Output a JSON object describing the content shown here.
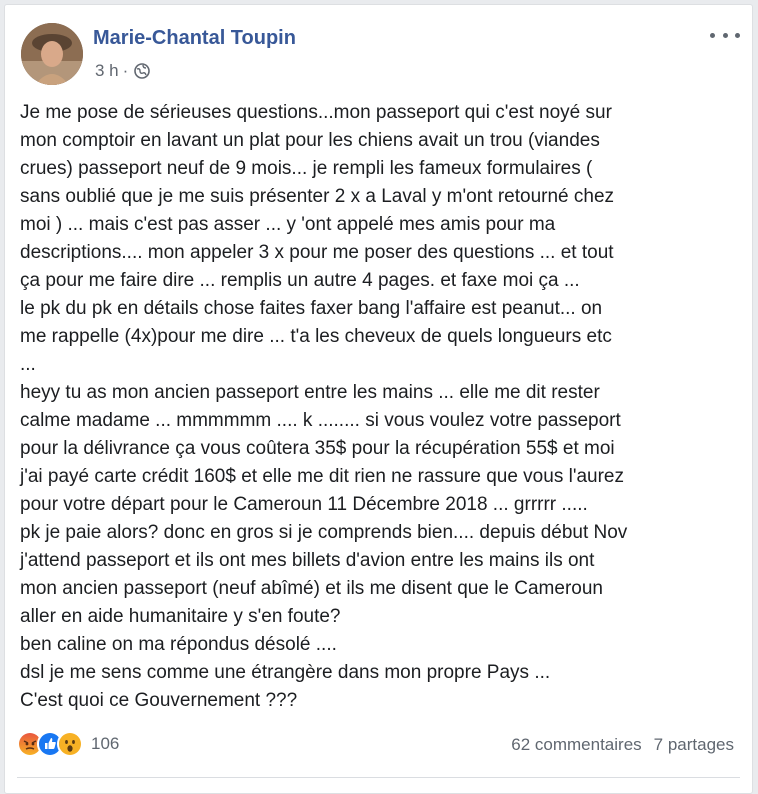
{
  "post": {
    "author": "Marie-Chantal Toupin",
    "time": "3 h",
    "privacy_icon": "globe-icon",
    "lines": [
      "Je me pose de sérieuses questions...mon passeport qui c'est noyé sur",
      "mon comptoir en lavant un plat pour les chiens avait un trou (viandes",
      "crues) passeport neuf de 9 mois... je rempli les fameux formulaires (",
      "sans oublié que je me suis présenter 2 x a Laval y m'ont retourné chez",
      "moi ) ... mais c'est pas asser ... y 'ont appelé mes amis pour ma",
      "descriptions.... mon appeler 3 x pour me poser des questions ... et tout",
      "ça pour me faire dire ... remplis un autre 4 pages. et faxe moi ça ...",
      "le pk du pk en détails chose faites faxer bang l'affaire est peanut... on",
      "me rappelle (4x)pour me dire ... t'a les cheveux de quels longueurs etc",
      "...",
      "heyy tu as mon ancien passeport entre les mains ... elle me dit rester",
      "calme madame ... mmmmmm .... k ........ si vous voulez votre passeport",
      "pour la délivrance ça vous coûtera 35$ pour la récupération 55$ et moi",
      "j'ai payé carte crédit 160$ et elle me dit rien ne rassure que vous l'aurez",
      "pour votre départ pour le Cameroun 11 Décembre 2018 ... grrrrr .....",
      "pk je paie alors? donc en gros si je comprends bien.... depuis début Nov",
      "j'attend passeport et ils ont mes billets d'avion entre les mains ils ont",
      "mon ancien passeport (neuf abîmé) et ils me disent que le Cameroun",
      "aller en aide humanitaire y s'en foute?",
      "ben caline on ma répondus désolé ....",
      "dsl je me sens comme une étrangère dans mon propre Pays ...",
      "C'est quoi ce Gouvernement ???"
    ]
  },
  "footer": {
    "reactions": [
      "angry-icon",
      "like-icon",
      "wow-icon"
    ],
    "reaction_count": "106",
    "comments": "62 commentaires",
    "shares": "7 partages"
  },
  "colors": {
    "author": "#385898",
    "text": "#1c1e21",
    "meta": "#616770",
    "angry": "#f0883c",
    "like": "#1877f2",
    "wow": "#f7b125"
  }
}
